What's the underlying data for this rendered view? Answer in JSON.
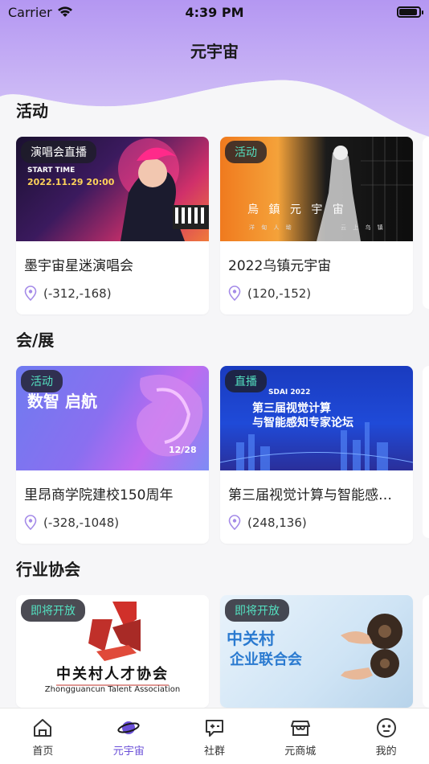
{
  "status": {
    "carrier": "Carrier",
    "time": "4:39 PM"
  },
  "page": {
    "title": "元宇宙"
  },
  "colors": {
    "header": "#b89cf0",
    "accent": "#6a4fd8",
    "tag_bg": "#23232d",
    "tag_text": "#53e0c0"
  },
  "sections": [
    {
      "title": "活动",
      "cards": [
        {
          "tag": "演唱会直播",
          "name": "墨宇宙星迷演唱会",
          "coord": "(-312,-168)",
          "poster_text": [
            "START TIME",
            "2022.11.29 20:00"
          ]
        },
        {
          "tag": "活动",
          "name": "2022乌镇元宇宙",
          "coord": "(120,-152)",
          "poster_text": [
            "烏 鎮 元 宇 宙",
            "洋 甸 人 坳",
            "云 上 乌 镇"
          ]
        }
      ]
    },
    {
      "title": "会/展",
      "cards": [
        {
          "tag": "活动",
          "name": "里昂商学院建校150周年",
          "coord": "(-328,-1048)",
          "poster_text": [
            "数智 启航",
            "12/28"
          ]
        },
        {
          "tag": "直播",
          "name": "第三届视觉计算与智能感知专家论坛",
          "coord": "(248,136)",
          "poster_text": [
            "SDAI 2022",
            "第三届视觉计算",
            "与智能感知专家论坛"
          ]
        }
      ]
    },
    {
      "title": "行业协会",
      "cards": [
        {
          "tag": "即将开放",
          "poster_text": [
            "中关村人才协会",
            "Zhongguancun Talent Association"
          ]
        },
        {
          "tag": "即将开放",
          "poster_text": [
            "中关村",
            "企业联合会"
          ]
        }
      ]
    }
  ],
  "tabs": [
    {
      "label": "首页",
      "icon": "home-icon"
    },
    {
      "label": "元宇宙",
      "icon": "planet-icon",
      "active": true
    },
    {
      "label": "社群",
      "icon": "chat-icon"
    },
    {
      "label": "元商城",
      "icon": "shop-icon"
    },
    {
      "label": "我的",
      "icon": "profile-icon"
    }
  ]
}
